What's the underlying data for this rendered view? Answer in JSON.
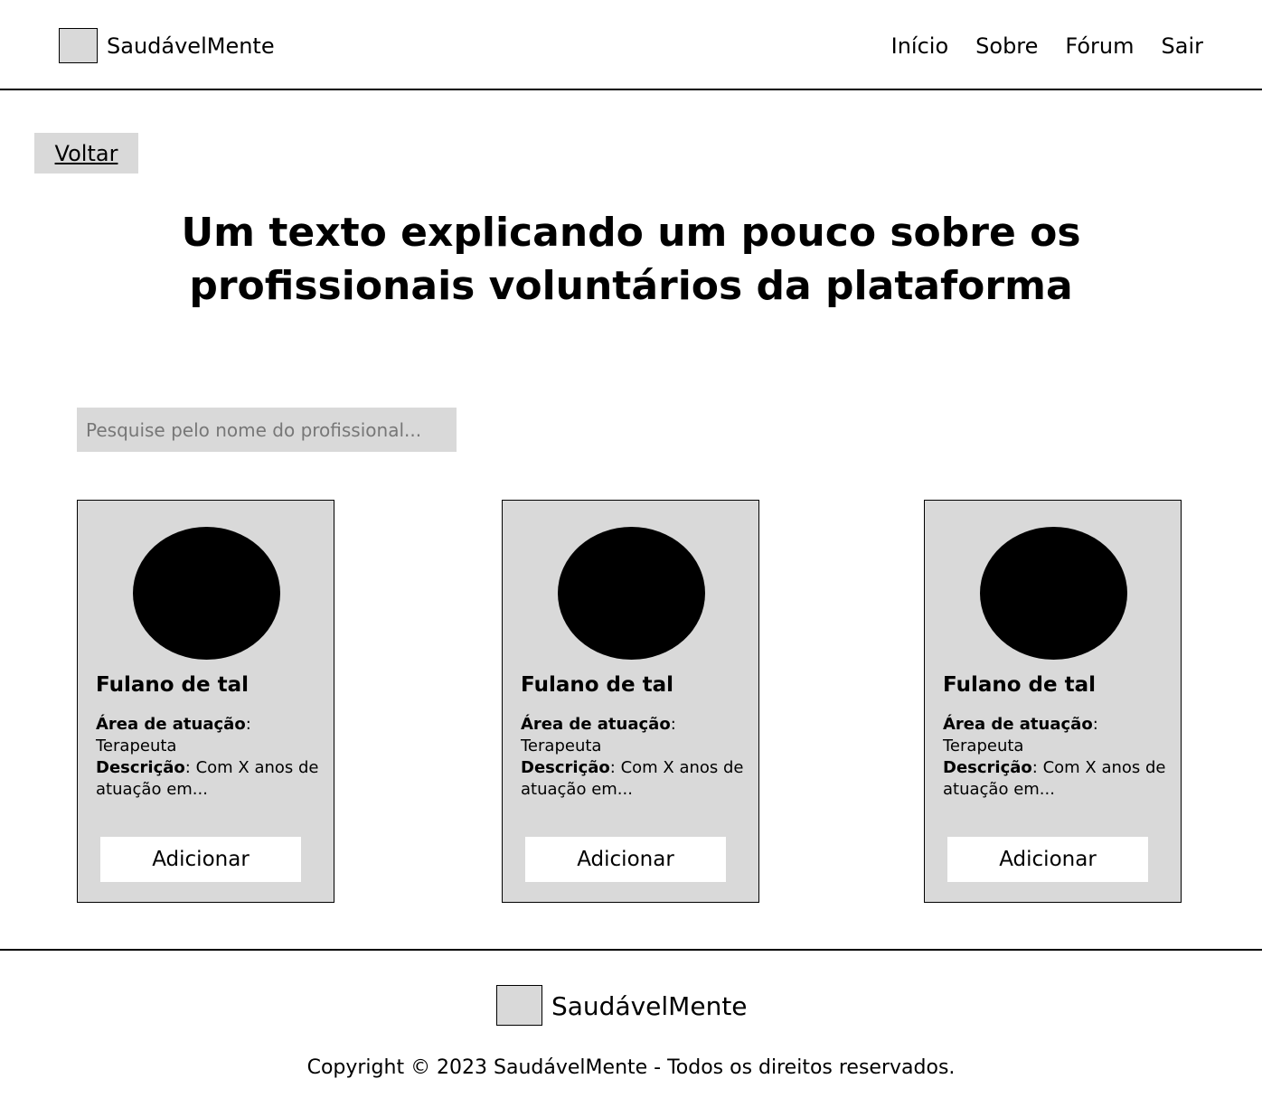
{
  "header": {
    "brand": "SaudávelMente",
    "nav": [
      "Início",
      "Sobre",
      "Fórum",
      "Sair"
    ]
  },
  "back_label": "Voltar",
  "title": "Um texto explicando um pouco sobre os profissionais voluntários da plataforma",
  "search": {
    "placeholder": "Pesquise pelo nome do profissional...",
    "value": ""
  },
  "cards": [
    {
      "name": "Fulano de tal",
      "area_label": "Área de atuação",
      "area_value": "Terapeuta",
      "desc_label": "Descrição",
      "desc_value": "Com X anos de atuação em...",
      "button": "Adicionar"
    },
    {
      "name": "Fulano de tal",
      "area_label": "Área de atuação",
      "area_value": "Terapeuta",
      "desc_label": "Descrição",
      "desc_value": "Com X anos de atuação em...",
      "button": "Adicionar"
    },
    {
      "name": "Fulano de tal",
      "area_label": "Área de atuação",
      "area_value": "Terapeuta",
      "desc_label": "Descrição",
      "desc_value": "Com X anos de atuação em...",
      "button": "Adicionar"
    }
  ],
  "footer": {
    "brand": "SaudávelMente",
    "copyright": "Copyright © 2023 SaudávelMente - Todos os direitos reservados."
  }
}
